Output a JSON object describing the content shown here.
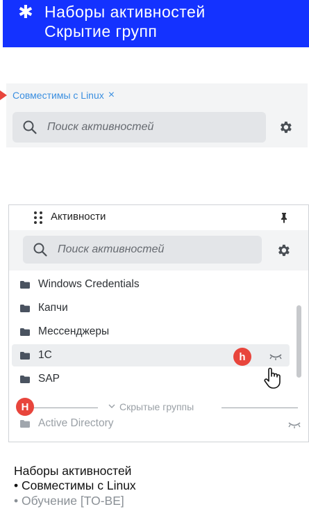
{
  "banner": {
    "icon": "asterisk-icon",
    "line1": "Наборы активностей",
    "line2": "Скрытие групп",
    "bg_color": "#1432ff"
  },
  "panel_top": {
    "filter_chip": "Совместимы с Linux",
    "filter_close": "×",
    "search_placeholder": "Поиск активностей"
  },
  "panel_activities": {
    "title": "Активности",
    "search_placeholder": "Поиск активностей",
    "items": [
      {
        "label": "Windows Credentials"
      },
      {
        "label": "Капчи"
      },
      {
        "label": "Мессенджеры"
      },
      {
        "label": "1С"
      },
      {
        "label": "SAP"
      }
    ],
    "hidden_section_label": "Скрытые группы",
    "hidden_items": [
      {
        "label": "Active Directory"
      }
    ],
    "badges": {
      "h": "h",
      "H": "H"
    }
  },
  "footer": {
    "line1": "Наборы активностей",
    "line2": "• Совместимы с Linux",
    "line3": "• Обучение  [TO-BE]"
  }
}
